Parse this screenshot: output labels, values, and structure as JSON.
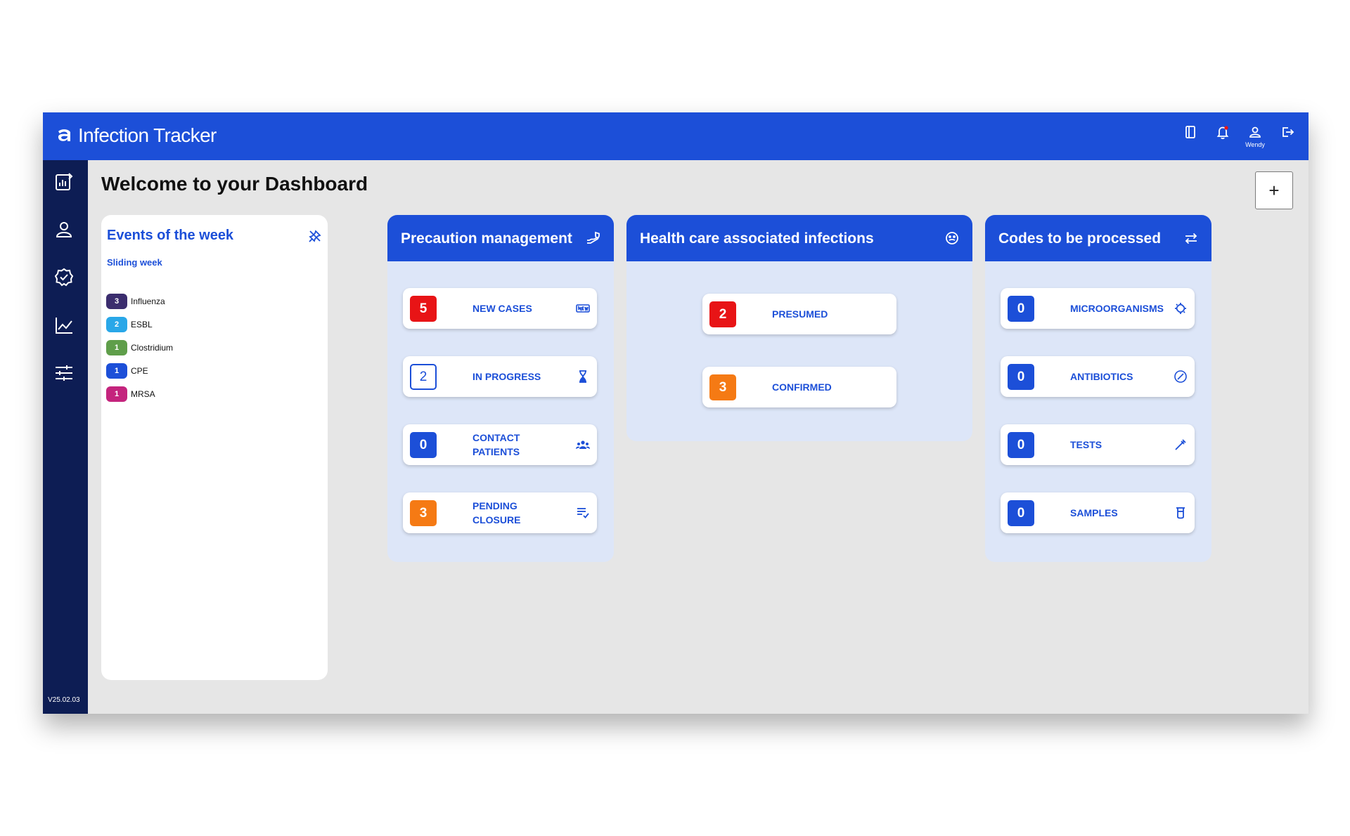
{
  "app": {
    "brand": "Infection Tracker",
    "version": "V25.02.03",
    "accent": "#1c4fd8",
    "sidebar_color": "#0d1d54"
  },
  "topbar": {
    "icons": [
      "book-icon",
      "bell-icon",
      "user-icon",
      "logout-icon"
    ],
    "user_name": "Wendy"
  },
  "sidebar": {
    "items": [
      {
        "name": "sidebar-item-reports",
        "icon": "report-chart-icon"
      },
      {
        "name": "sidebar-item-patients",
        "icon": "person-icon"
      },
      {
        "name": "sidebar-item-validation",
        "icon": "badge-check-icon"
      },
      {
        "name": "sidebar-item-statistics",
        "icon": "line-chart-icon"
      },
      {
        "name": "sidebar-item-settings",
        "icon": "sliders-icon"
      }
    ]
  },
  "main": {
    "title": "Welcome to your Dashboard",
    "add_label": "+"
  },
  "events": {
    "title": "Events of the week",
    "subtitle": "Sliding week",
    "items": [
      {
        "count": "3",
        "label": "Influenza",
        "color": "#3b2d6e"
      },
      {
        "count": "2",
        "label": "ESBL",
        "color": "#29a7e8"
      },
      {
        "count": "1",
        "label": "Clostridium",
        "color": "#5f9e4a"
      },
      {
        "count": "1",
        "label": "CPE",
        "color": "#1c4fd8"
      },
      {
        "count": "1",
        "label": "MRSA",
        "color": "#c4247d"
      }
    ]
  },
  "precaution": {
    "title": "Precaution management",
    "tiles": [
      {
        "count": "5",
        "label": "NEW CASES",
        "color": "#e81416",
        "icon": "new-icon"
      },
      {
        "count": "2",
        "label": "IN PROGRESS",
        "color": "outline",
        "icon": "hourglass-icon"
      },
      {
        "count": "0",
        "label": "CONTACT\nPATIENTS",
        "color": "#1c4fd8",
        "icon": "group-icon"
      },
      {
        "count": "3",
        "label": "PENDING\nCLOSURE",
        "color": "#f57a14",
        "icon": "list-check-icon"
      }
    ]
  },
  "hai": {
    "title": "Health care associated infections",
    "tiles": [
      {
        "count": "2",
        "label": "PRESUMED",
        "color": "#e81416"
      },
      {
        "count": "3",
        "label": "CONFIRMED",
        "color": "#f57a14"
      }
    ]
  },
  "codes": {
    "title": "Codes to be processed",
    "tiles": [
      {
        "count": "0",
        "label": "MICROORGANISMS",
        "color": "#1c4fd8",
        "icon": "microbe-icon"
      },
      {
        "count": "0",
        "label": "ANTIBIOTICS",
        "color": "#1c4fd8",
        "icon": "pill-icon"
      },
      {
        "count": "0",
        "label": "TESTS",
        "color": "#1c4fd8",
        "icon": "pipette-icon"
      },
      {
        "count": "0",
        "label": "SAMPLES",
        "color": "#1c4fd8",
        "icon": "tube-icon"
      }
    ]
  }
}
